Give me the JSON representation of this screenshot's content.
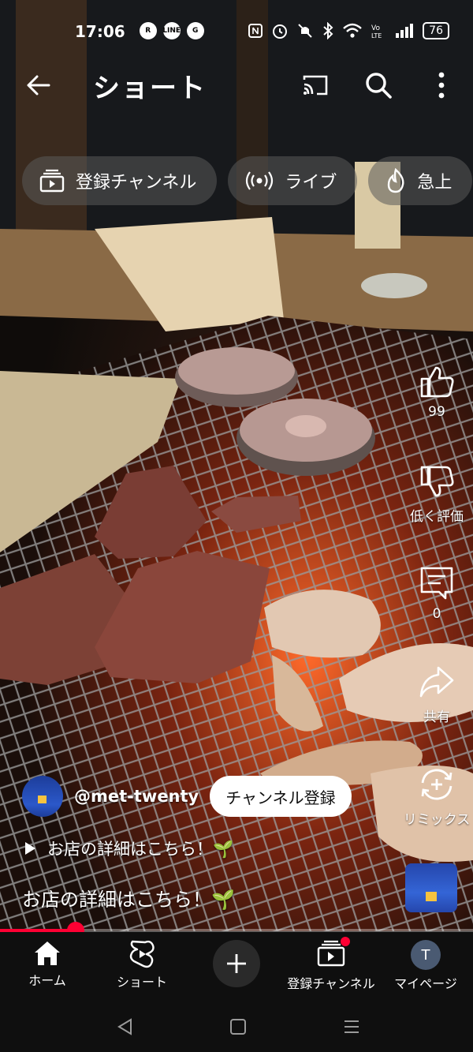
{
  "status_bar": {
    "time": "17:06",
    "apps": [
      "R",
      "LINE",
      "G"
    ],
    "indicators": [
      "nfc-icon",
      "alarm-icon",
      "mute-icon",
      "bluetooth-icon",
      "wifi-icon",
      "volte-icon",
      "signal-icon"
    ],
    "battery": "76"
  },
  "header": {
    "title": "ショート"
  },
  "chips": [
    {
      "label": "登録チャンネル",
      "icon": "subscriptions-icon"
    },
    {
      "label": "ライブ",
      "icon": "live-icon"
    },
    {
      "label": "急上",
      "icon": "trending-icon"
    }
  ],
  "actions": {
    "like_count": "99",
    "dislike_label": "低く評価",
    "comment_count": "0",
    "share_label": "共有",
    "remix_label": "リミックス"
  },
  "channel": {
    "name": "@met-twenty",
    "subscribe_label": "チャンネル登録"
  },
  "description": {
    "link_text": "お店の詳細はこちら！🌱",
    "caption": "お店の詳細はこちら！🌱"
  },
  "progress": {
    "fraction": 0.16
  },
  "bottom_nav": {
    "home": "ホーム",
    "shorts": "ショート",
    "subscriptions": "登録チャンネル",
    "profile": "マイページ",
    "avatar_letter": "T"
  },
  "colors": {
    "accent": "#ff0033",
    "nav_bg": "#0f0f0f"
  }
}
